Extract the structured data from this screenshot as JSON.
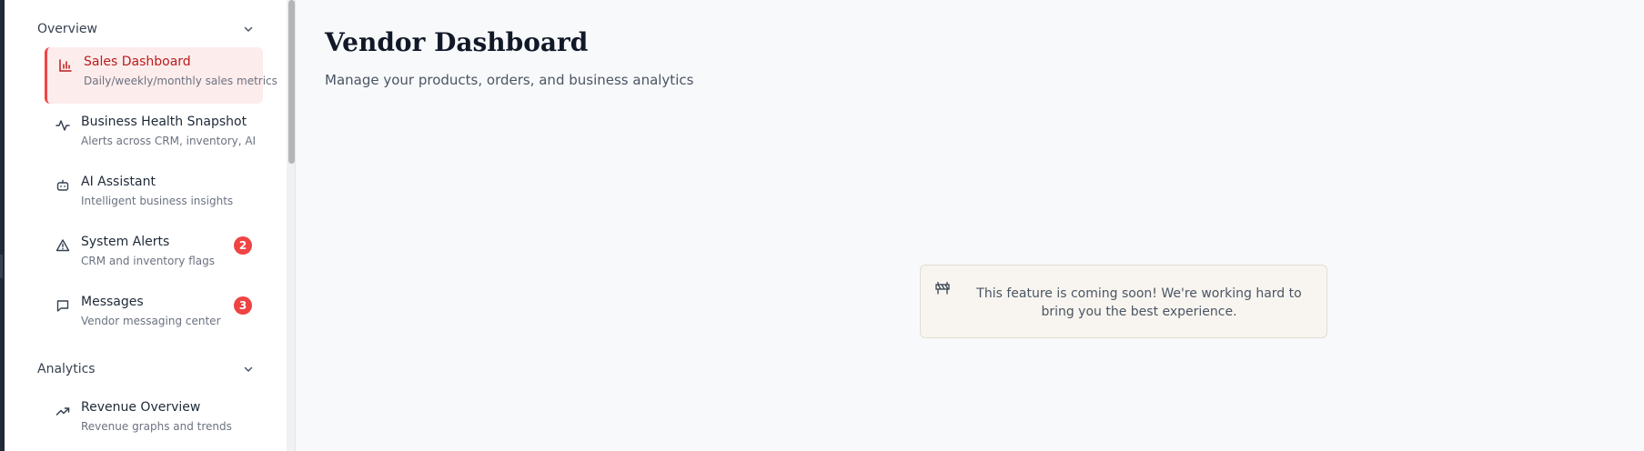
{
  "sidebar": {
    "sections": [
      {
        "label": "Overview",
        "items": [
          {
            "label": "Sales Dashboard",
            "sub": "Daily/weekly/monthly sales metrics",
            "icon": "bar-chart-icon",
            "active": true
          },
          {
            "label": "Business Health Snapshot",
            "sub": "Alerts across CRM, inventory, AI",
            "icon": "activity-pulse-icon"
          },
          {
            "label": "AI Assistant",
            "sub": "Intelligent business insights",
            "icon": "bot-icon"
          },
          {
            "label": "System Alerts",
            "sub": "CRM and inventory flags",
            "icon": "warning-triangle-icon",
            "badge": "2"
          },
          {
            "label": "Messages",
            "sub": "Vendor messaging center",
            "icon": "message-square-icon",
            "badge": "3"
          }
        ]
      },
      {
        "label": "Analytics",
        "items": [
          {
            "label": "Revenue Overview",
            "sub": "Revenue graphs and trends",
            "icon": "trending-up-icon"
          }
        ]
      }
    ]
  },
  "main": {
    "title": "Vendor Dashboard",
    "subtitle": "Manage your products, orders, and business analytics",
    "notice": {
      "icon": "construction-barrier-icon",
      "text": "This feature is coming soon! We're working hard to bring you the best experience."
    }
  },
  "colors": {
    "accent": "#ef4444",
    "active_bg": "#fdecec",
    "active_text": "#b91c1c",
    "page_bg": "#f8f9fb",
    "notice_bg": "#f8f5f0"
  }
}
